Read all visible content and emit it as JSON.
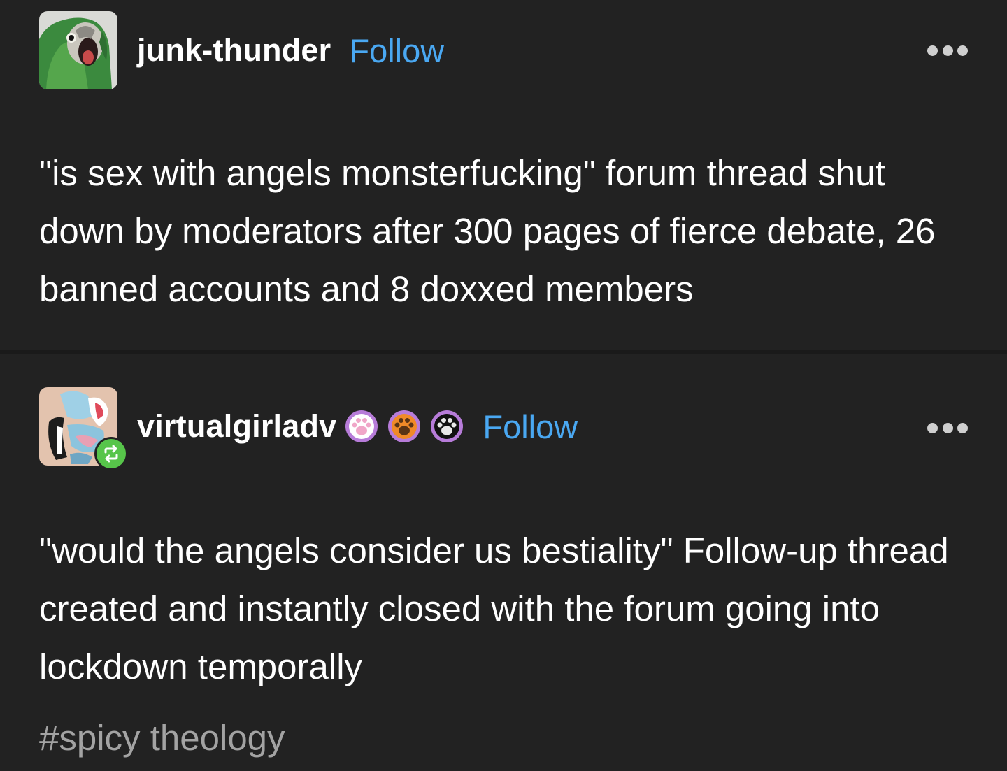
{
  "colors": {
    "background": "#222222",
    "text": "#ffffff",
    "follow": "#4aa8f2",
    "tag": "#a3a3a3",
    "reblog": "#57c54a"
  },
  "posts": [
    {
      "username": "junk-thunder",
      "follow_label": "Follow",
      "avatar_icon": "parrot-avatar",
      "menu_icon": "more-dots-icon",
      "text": "\"is sex with angels monsterfucking\" forum thread shut down by moderators after 300 pages of fierce debate, 26 banned accounts and 8 doxxed members"
    },
    {
      "username": "virtualgirladv",
      "follow_label": "Follow",
      "avatar_icon": "illustration-avatar",
      "reblog_icon": "reblog-icon",
      "badges": [
        "pink-paw-badge",
        "orange-paw-badge",
        "black-paw-badge"
      ],
      "menu_icon": "more-dots-icon",
      "text": "\"would the angels consider us bestiality\" Follow-up thread created and instantly closed with the forum going into lockdown temporally",
      "tag": "#spicy theology"
    }
  ]
}
